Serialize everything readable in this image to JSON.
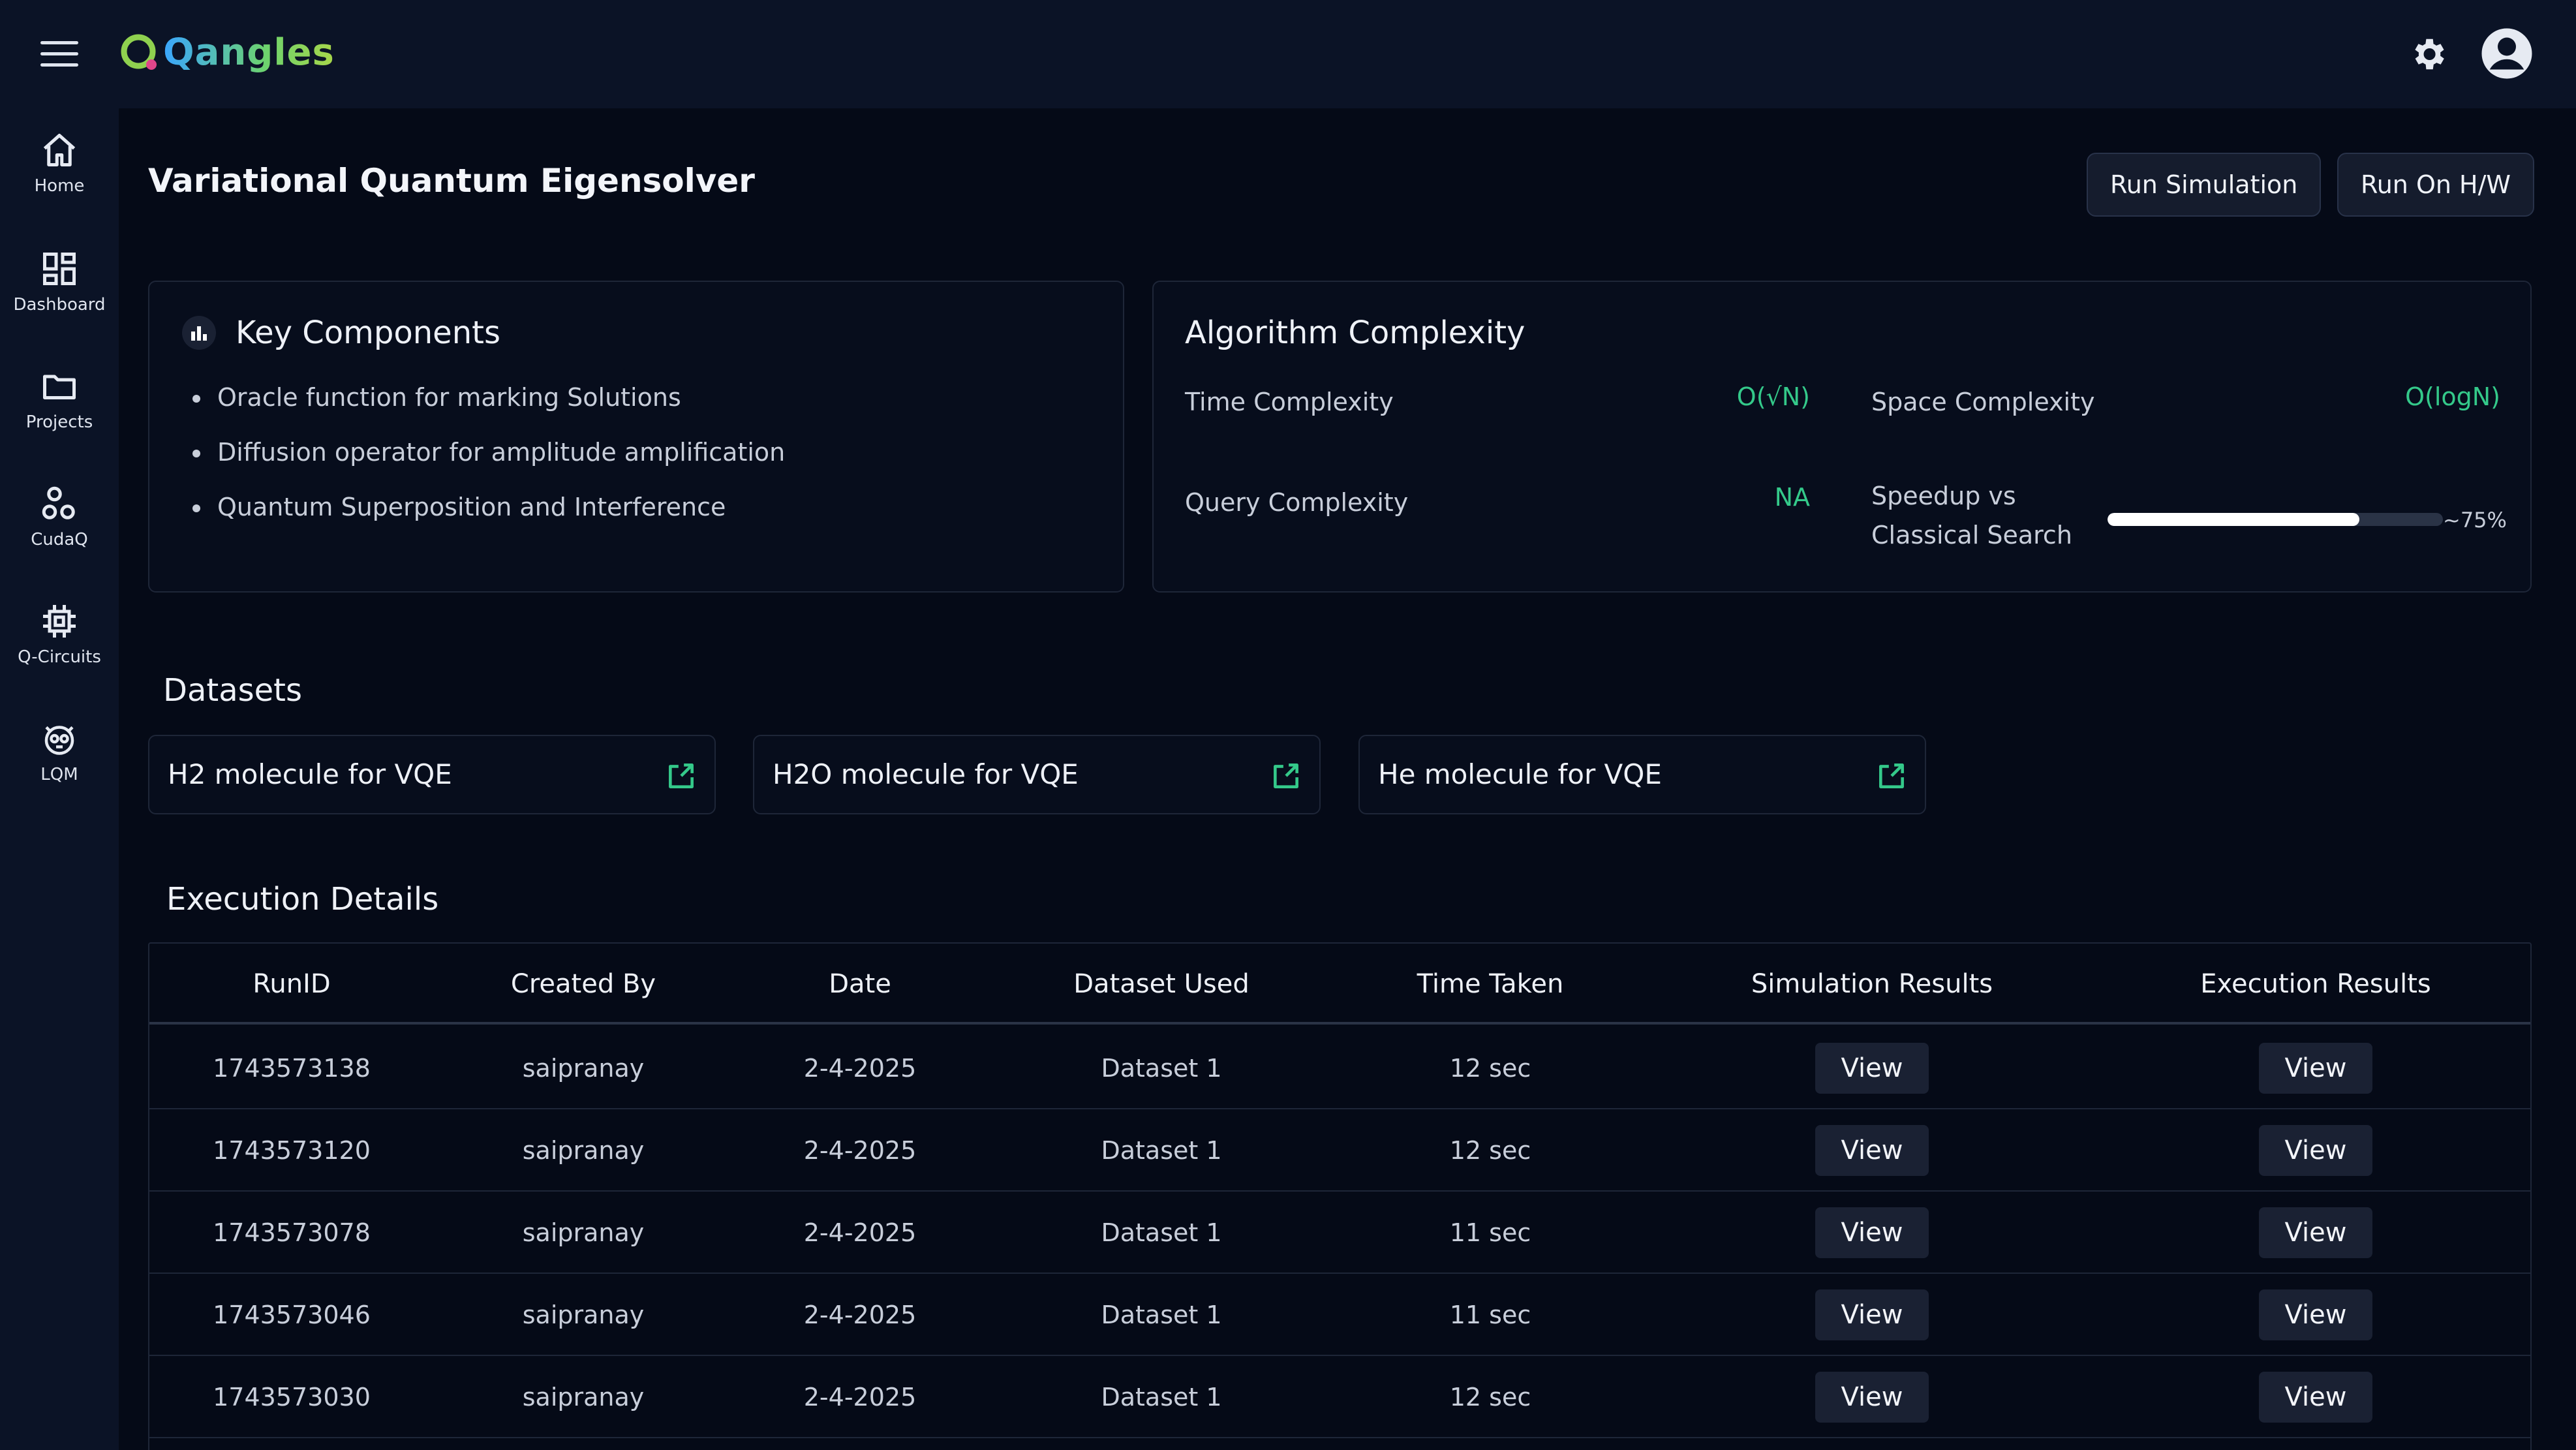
{
  "app": {
    "brand": "Qangles",
    "colors": {
      "accent_green": "#34c98a",
      "background": "#050a17",
      "panel": "#0b1326"
    }
  },
  "sidebar": {
    "items": [
      {
        "label": "Home",
        "icon": "home-icon"
      },
      {
        "label": "Dashboard",
        "icon": "dashboard-icon"
      },
      {
        "label": "Projects",
        "icon": "folder-icon"
      },
      {
        "label": "CudaQ",
        "icon": "cudaq-icon"
      },
      {
        "label": "Q-Circuits",
        "icon": "chip-icon"
      },
      {
        "label": "LQM",
        "icon": "lqm-icon"
      }
    ]
  },
  "header": {
    "title": "Variational Quantum Eigensolver",
    "run_simulation": "Run Simulation",
    "run_hw": "Run On H/W"
  },
  "key_components": {
    "title": "Key Components",
    "items": [
      "Oracle function for marking Solutions",
      "Diffusion operator for amplitude amplification",
      "Quantum Superposition and Interference"
    ]
  },
  "complexity": {
    "title": "Algorithm Complexity",
    "time_label": "Time Complexity",
    "time_value": "O(√N)",
    "space_label": "Space Complexity",
    "space_value": "O(logN)",
    "query_label": "Query Complexity",
    "query_value": "NA",
    "speedup_label_1": "Speedup vs",
    "speedup_label_2": "Classical Search",
    "speedup_value": 0.75,
    "speedup_text": "~75%"
  },
  "datasets": {
    "title": "Datasets",
    "items": [
      "H2 molecule for VQE",
      "H2O molecule for VQE",
      "He molecule for VQE"
    ]
  },
  "execution": {
    "title": "Execution Details",
    "columns": [
      "RunID",
      "Created By",
      "Date",
      "Dataset Used",
      "Time Taken",
      "Simulation Results",
      "Execution Results"
    ],
    "view_label": "View",
    "rows": [
      {
        "run_id": "1743573138",
        "created_by": "saipranay",
        "date": "2-4-2025",
        "dataset": "Dataset 1",
        "time": "12 sec"
      },
      {
        "run_id": "1743573120",
        "created_by": "saipranay",
        "date": "2-4-2025",
        "dataset": "Dataset 1",
        "time": "12 sec"
      },
      {
        "run_id": "1743573078",
        "created_by": "saipranay",
        "date": "2-4-2025",
        "dataset": "Dataset 1",
        "time": "11 sec"
      },
      {
        "run_id": "1743573046",
        "created_by": "saipranay",
        "date": "2-4-2025",
        "dataset": "Dataset 1",
        "time": "11 sec"
      },
      {
        "run_id": "1743573030",
        "created_by": "saipranay",
        "date": "2-4-2025",
        "dataset": "Dataset 1",
        "time": "12 sec"
      }
    ]
  }
}
